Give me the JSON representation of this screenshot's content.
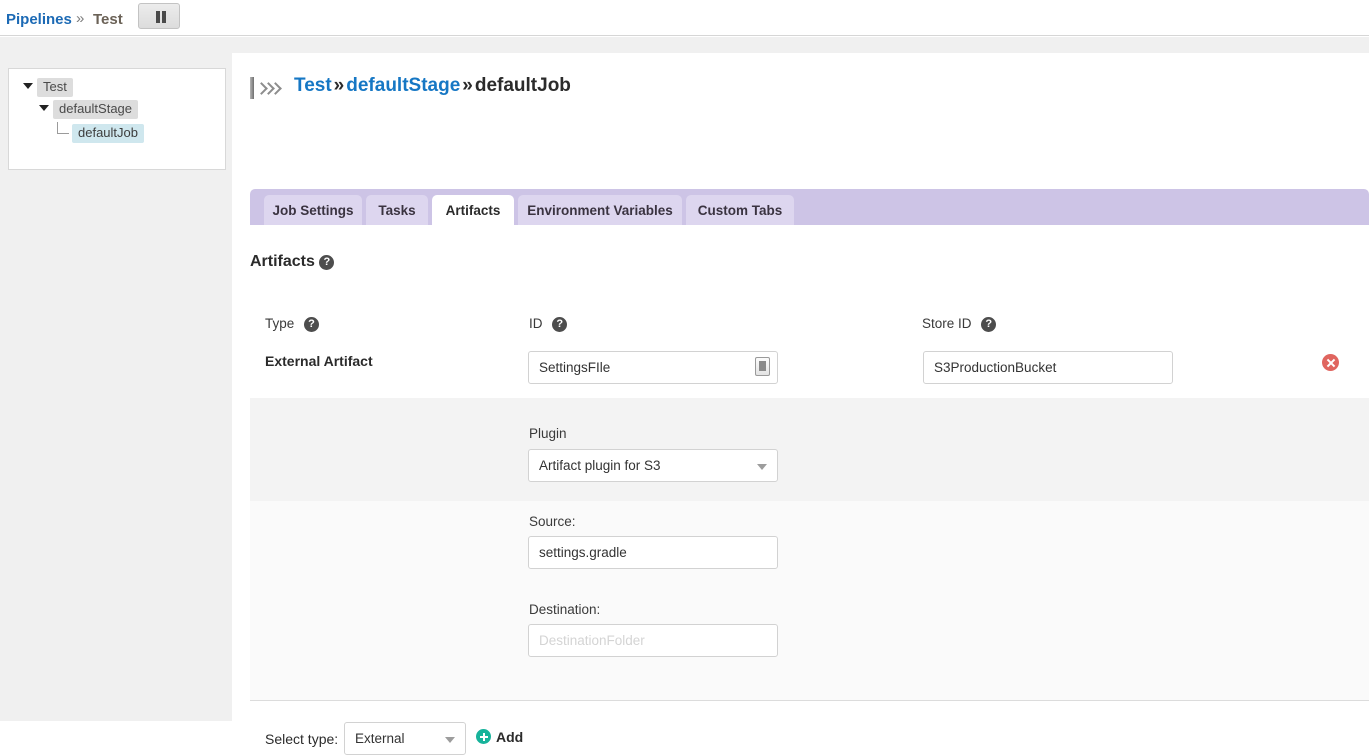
{
  "topbar": {
    "pipelines_link": "Pipelines",
    "separator": "»",
    "current": "Test",
    "pause_button_name": "pause-button"
  },
  "sidebar": {
    "nodes": [
      {
        "label": "Test",
        "state": "expanded",
        "selected": false
      },
      {
        "label": "defaultStage",
        "state": "expanded",
        "selected": false
      },
      {
        "label": "defaultJob",
        "state": "leaf",
        "selected": true
      }
    ]
  },
  "breadcrumb": {
    "pipeline": "Test",
    "sep1": "»",
    "stage": "defaultStage",
    "sep2": "»",
    "job": "defaultJob"
  },
  "tabs": [
    {
      "label": "Job Settings",
      "active": false
    },
    {
      "label": "Tasks",
      "active": false
    },
    {
      "label": "Artifacts",
      "active": true
    },
    {
      "label": "Environment Variables",
      "active": false
    },
    {
      "label": "Custom Tabs",
      "active": false
    }
  ],
  "section": {
    "title": "Artifacts",
    "help_glyph": "?"
  },
  "columns": {
    "type": "Type",
    "id": "ID",
    "store_id": "Store ID"
  },
  "artifact": {
    "type_value": "External Artifact",
    "id_value": "SettingsFIle",
    "id_placeholder": "",
    "store_id_value": "S3ProductionBucket",
    "store_id_placeholder": "",
    "plugin_label": "Plugin",
    "plugin_value": "Artifact plugin for S3",
    "source_label": "Source:",
    "source_value": "settings.gradle",
    "destination_label": "Destination:",
    "destination_value": "",
    "destination_placeholder": "DestinationFolder"
  },
  "footer": {
    "select_type_label": "Select type:",
    "select_type_value": "External",
    "add_label": "Add"
  },
  "colors": {
    "tabbar_bg": "#cdc4e6",
    "tab_bg": "#ddd6ef",
    "link_blue": "#1677c4",
    "delete_red": "#e0655f",
    "add_green": "#17b39b",
    "tree_selected": "#cfe7ee"
  }
}
